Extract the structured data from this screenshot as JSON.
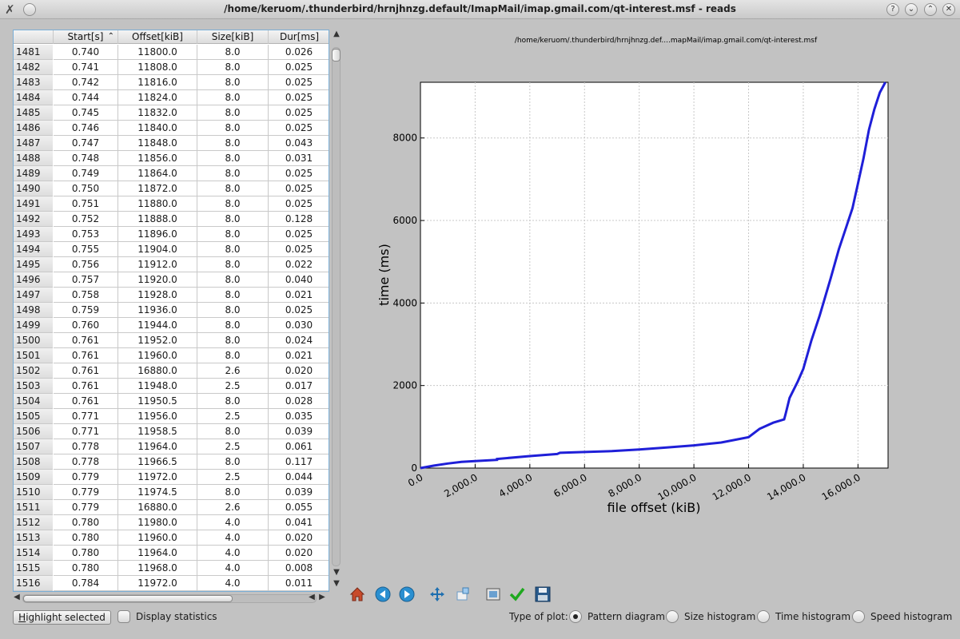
{
  "window": {
    "title": "/home/keruom/.thunderbird/hrnjhnzg.default/ImapMail/imap.gmail.com/qt-interest.msf - reads",
    "buttons": [
      "?",
      "⌄",
      "⌃",
      "✕"
    ]
  },
  "table": {
    "columns": [
      "Start[s]",
      "Offset[kiB]",
      "Size[kiB]",
      "Dur[ms]"
    ],
    "rows": [
      [
        "1481",
        "0.740",
        "11800.0",
        "8.0",
        "0.026"
      ],
      [
        "1482",
        "0.741",
        "11808.0",
        "8.0",
        "0.025"
      ],
      [
        "1483",
        "0.742",
        "11816.0",
        "8.0",
        "0.025"
      ],
      [
        "1484",
        "0.744",
        "11824.0",
        "8.0",
        "0.025"
      ],
      [
        "1485",
        "0.745",
        "11832.0",
        "8.0",
        "0.025"
      ],
      [
        "1486",
        "0.746",
        "11840.0",
        "8.0",
        "0.025"
      ],
      [
        "1487",
        "0.747",
        "11848.0",
        "8.0",
        "0.043"
      ],
      [
        "1488",
        "0.748",
        "11856.0",
        "8.0",
        "0.031"
      ],
      [
        "1489",
        "0.749",
        "11864.0",
        "8.0",
        "0.025"
      ],
      [
        "1490",
        "0.750",
        "11872.0",
        "8.0",
        "0.025"
      ],
      [
        "1491",
        "0.751",
        "11880.0",
        "8.0",
        "0.025"
      ],
      [
        "1492",
        "0.752",
        "11888.0",
        "8.0",
        "0.128"
      ],
      [
        "1493",
        "0.753",
        "11896.0",
        "8.0",
        "0.025"
      ],
      [
        "1494",
        "0.755",
        "11904.0",
        "8.0",
        "0.025"
      ],
      [
        "1495",
        "0.756",
        "11912.0",
        "8.0",
        "0.022"
      ],
      [
        "1496",
        "0.757",
        "11920.0",
        "8.0",
        "0.040"
      ],
      [
        "1497",
        "0.758",
        "11928.0",
        "8.0",
        "0.021"
      ],
      [
        "1498",
        "0.759",
        "11936.0",
        "8.0",
        "0.025"
      ],
      [
        "1499",
        "0.760",
        "11944.0",
        "8.0",
        "0.030"
      ],
      [
        "1500",
        "0.761",
        "11952.0",
        "8.0",
        "0.024"
      ],
      [
        "1501",
        "0.761",
        "11960.0",
        "8.0",
        "0.021"
      ],
      [
        "1502",
        "0.761",
        "16880.0",
        "2.6",
        "0.020"
      ],
      [
        "1503",
        "0.761",
        "11948.0",
        "2.5",
        "0.017"
      ],
      [
        "1504",
        "0.761",
        "11950.5",
        "8.0",
        "0.028"
      ],
      [
        "1505",
        "0.771",
        "11956.0",
        "2.5",
        "0.035"
      ],
      [
        "1506",
        "0.771",
        "11958.5",
        "8.0",
        "0.039"
      ],
      [
        "1507",
        "0.778",
        "11964.0",
        "2.5",
        "0.061"
      ],
      [
        "1508",
        "0.778",
        "11966.5",
        "8.0",
        "0.117"
      ],
      [
        "1509",
        "0.779",
        "11972.0",
        "2.5",
        "0.044"
      ],
      [
        "1510",
        "0.779",
        "11974.5",
        "8.0",
        "0.039"
      ],
      [
        "1511",
        "0.779",
        "16880.0",
        "2.6",
        "0.055"
      ],
      [
        "1512",
        "0.780",
        "11980.0",
        "4.0",
        "0.041"
      ],
      [
        "1513",
        "0.780",
        "11960.0",
        "4.0",
        "0.020"
      ],
      [
        "1514",
        "0.780",
        "11964.0",
        "4.0",
        "0.020"
      ],
      [
        "1515",
        "0.780",
        "11968.0",
        "4.0",
        "0.008"
      ],
      [
        "1516",
        "0.784",
        "11972.0",
        "4.0",
        "0.011"
      ]
    ]
  },
  "controls": {
    "highlight_label_u": "H",
    "highlight_label_rest": "ighlight selected",
    "display_statistics": "Display statistics",
    "type_of_plot": "Type of plot:",
    "plot_types": [
      "Pattern diagram",
      "Size histogram",
      "Time histogram",
      "Speed histogram"
    ],
    "selected_plot_type": "Pattern diagram"
  },
  "toolbar": {
    "icons": [
      "home-icon",
      "back-icon",
      "forward-icon",
      "pan-icon",
      "zoom-icon",
      "subplots-icon",
      "check-icon",
      "save-icon"
    ]
  },
  "chart_data": {
    "type": "line",
    "title": "/home/keruom/.thunderbird/hrnjhnzg.def....mapMail/imap.gmail.com/qt-interest.msf",
    "xlabel": "file offset (kiB)",
    "ylabel": "time (ms)",
    "xlim": [
      0,
      17100
    ],
    "ylim": [
      0,
      9350
    ],
    "x_ticks": [
      "0.0",
      "2,000.0",
      "4,000.0",
      "6,000.0",
      "8,000.0",
      "10,000.0",
      "12,000.0",
      "14,000.0",
      "16,000.0"
    ],
    "x_tick_values": [
      0,
      2000,
      4000,
      6000,
      8000,
      10000,
      12000,
      14000,
      16000
    ],
    "y_ticks": [
      "0",
      "2000",
      "4000",
      "6000",
      "8000"
    ],
    "y_tick_values": [
      0,
      2000,
      4000,
      6000,
      8000
    ],
    "grid": true,
    "color": "#1f1fd8",
    "x": [
      0,
      500,
      1000,
      1500,
      2000,
      2800,
      2800,
      4000,
      5000,
      5100,
      6000,
      7000,
      8000,
      9000,
      10000,
      11000,
      12000,
      12400,
      12900,
      13300,
      13350,
      13500,
      13800,
      14000,
      14300,
      14600,
      15000,
      15300,
      15600,
      15800,
      16000,
      16200,
      16400,
      16600,
      16800,
      17000
    ],
    "y": [
      0,
      60,
      110,
      150,
      170,
      200,
      220,
      290,
      340,
      370,
      390,
      410,
      450,
      500,
      550,
      620,
      750,
      950,
      1100,
      1180,
      1300,
      1700,
      2100,
      2400,
      3100,
      3700,
      4600,
      5300,
      5900,
      6300,
      6900,
      7500,
      8200,
      8700,
      9100,
      9350
    ]
  }
}
